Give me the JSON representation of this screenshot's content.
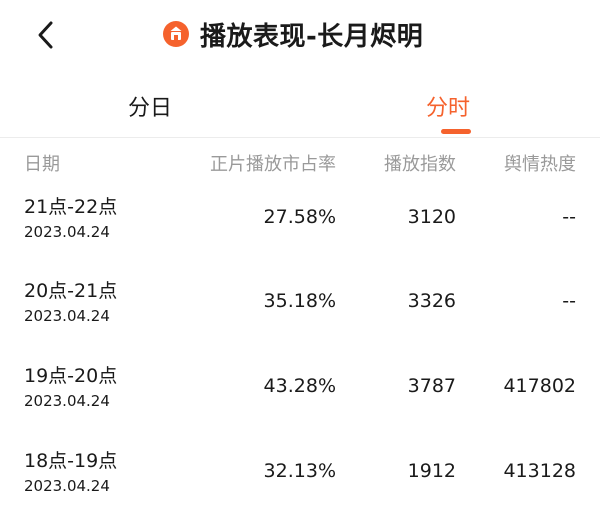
{
  "header": {
    "title": "播放表现-长月烬明"
  },
  "tabs": [
    {
      "label": "分日",
      "active": false
    },
    {
      "label": "分时",
      "active": true
    }
  ],
  "colors": {
    "accent": "#f5622d",
    "text": "#1a1a1a",
    "muted": "#9a9a9a"
  },
  "table": {
    "columns": [
      "日期",
      "正片播放市占率",
      "播放指数",
      "舆情热度"
    ],
    "rows": [
      {
        "time": "21点-22点",
        "date": "2023.04.24",
        "share": "27.58%",
        "index": "3120",
        "heat": "--"
      },
      {
        "time": "20点-21点",
        "date": "2023.04.24",
        "share": "35.18%",
        "index": "3326",
        "heat": "--"
      },
      {
        "time": "19点-20点",
        "date": "2023.04.24",
        "share": "43.28%",
        "index": "3787",
        "heat": "417802"
      },
      {
        "time": "18点-19点",
        "date": "2023.04.24",
        "share": "32.13%",
        "index": "1912",
        "heat": "413128"
      }
    ]
  }
}
